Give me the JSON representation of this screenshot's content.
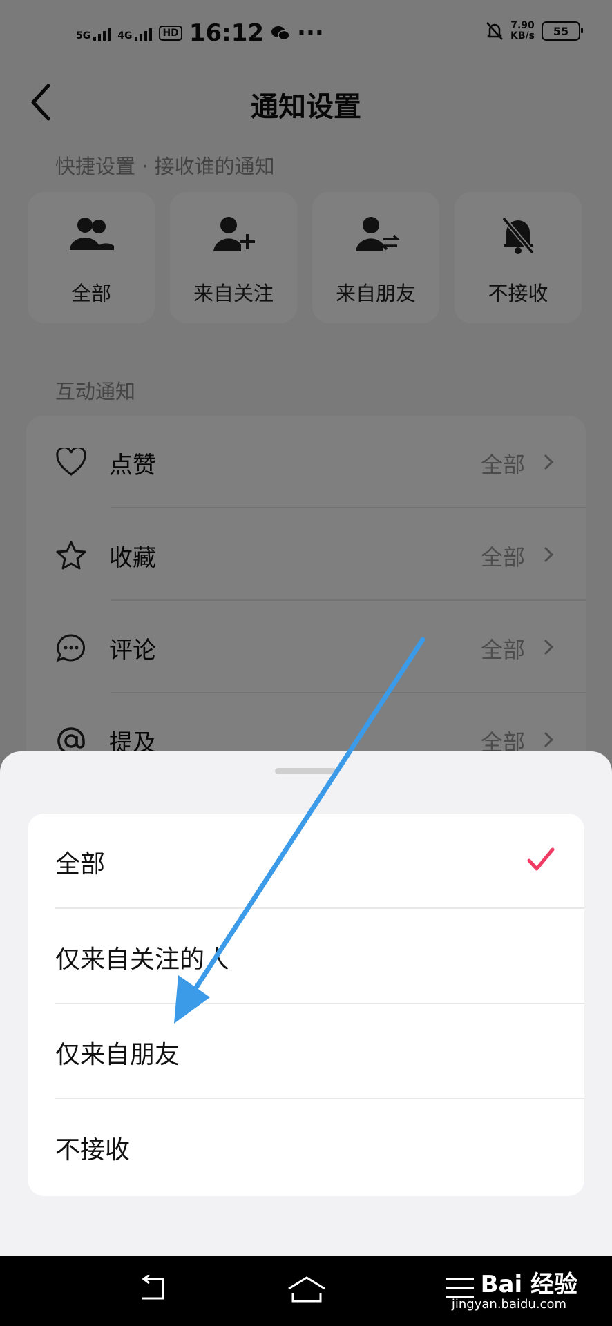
{
  "status_bar": {
    "net1": "5G",
    "net2": "4G",
    "hd": "HD",
    "time": "16:12",
    "more": "···",
    "speed_value": "7.90",
    "speed_unit": "KB/s",
    "battery": "55"
  },
  "header": {
    "title": "通知设置"
  },
  "quick": {
    "section_label": "快捷设置 · 接收谁的通知",
    "items": [
      {
        "label": "全部",
        "icon": "group-icon"
      },
      {
        "label": "来自关注",
        "icon": "add-user-icon"
      },
      {
        "label": "来自朋友",
        "icon": "friend-exchange-icon"
      },
      {
        "label": "不接收",
        "icon": "bell-off-icon"
      }
    ]
  },
  "interaction": {
    "section_label": "互动通知",
    "rows": [
      {
        "label": "点赞",
        "value": "全部",
        "icon": "heart-icon"
      },
      {
        "label": "收藏",
        "value": "全部",
        "icon": "star-icon"
      },
      {
        "label": "评论",
        "value": "全部",
        "icon": "comment-icon"
      },
      {
        "label": "提及",
        "value": "全部",
        "icon": "at-icon"
      }
    ]
  },
  "sheet": {
    "options": [
      {
        "label": "全部",
        "selected": true
      },
      {
        "label": "仅来自关注的人",
        "selected": false
      },
      {
        "label": "仅来自朋友",
        "selected": false
      },
      {
        "label": "不接收",
        "selected": false
      }
    ],
    "accent": "#f03c64"
  },
  "watermark": {
    "brand": "Bai 经验",
    "url": "jingyan.baidu.com"
  },
  "annotation": {
    "arrow_color": "#3b9be8"
  }
}
